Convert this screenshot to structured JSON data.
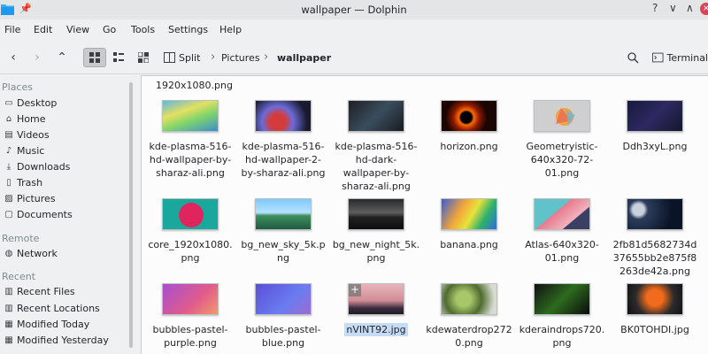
{
  "window": {
    "title": "wallpaper — Dolphin",
    "controls": {
      "help": "?",
      "minimize": "∨",
      "maximize": "∧",
      "close": "×"
    }
  },
  "menu": [
    "File",
    "Edit",
    "View",
    "Go",
    "Tools",
    "Settings",
    "Help"
  ],
  "toolbar": {
    "split_label": "Split",
    "terminal_label": "Terminal"
  },
  "breadcrumb": [
    "Pictures",
    "wallpaper"
  ],
  "sidebar": {
    "sections": {
      "places": "Places",
      "remote": "Remote",
      "recent": "Recent"
    },
    "places": [
      "Desktop",
      "Home",
      "Videos",
      "Music",
      "Downloads",
      "Trash",
      "Pictures",
      "Documents"
    ],
    "remote": [
      "Network"
    ],
    "recent": [
      "Recent Files",
      "Recent Locations",
      "Modified Today",
      "Modified Yesterday"
    ]
  },
  "main": {
    "top_partial_name": "1920x1080.png",
    "files": [
      {
        "name": "kde-plasma-516-hd-wallpaper-by-sharaz-ali.png"
      },
      {
        "name": "kde-plasma-516-hd-wallpaper-2-by-sharaz-ali.png"
      },
      {
        "name": "kde-plasma-516-hd-dark-wallpaper-by-sharaz-ali.png"
      },
      {
        "name": "horizon.png"
      },
      {
        "name": "Geometryistic-640x320-72-01.png"
      },
      {
        "name": "Ddh3xyL.png"
      },
      {
        "name": "core_1920x1080.png"
      },
      {
        "name": "bg_new_sky_5k.png"
      },
      {
        "name": "bg_new_night_5k.png"
      },
      {
        "name": "banana.png"
      },
      {
        "name": "Atlas-640x320-01.png"
      },
      {
        "name": "2fb81d5682734d37655bb2e875f8263de42a.png"
      },
      {
        "name": "bubbles-pastel-purple.png"
      },
      {
        "name": "bubbles-pastel-blue.png"
      },
      {
        "name": "nVINT92.jpg"
      },
      {
        "name": "kdewaterdrop2720.png"
      },
      {
        "name": "kderaindrops720.png"
      },
      {
        "name": "BK0TOHDI.jpg"
      }
    ]
  },
  "colors": {
    "accent_selection": "#c5dcf4",
    "close_button": "#da4453",
    "folder_icon": "#3daee9"
  }
}
